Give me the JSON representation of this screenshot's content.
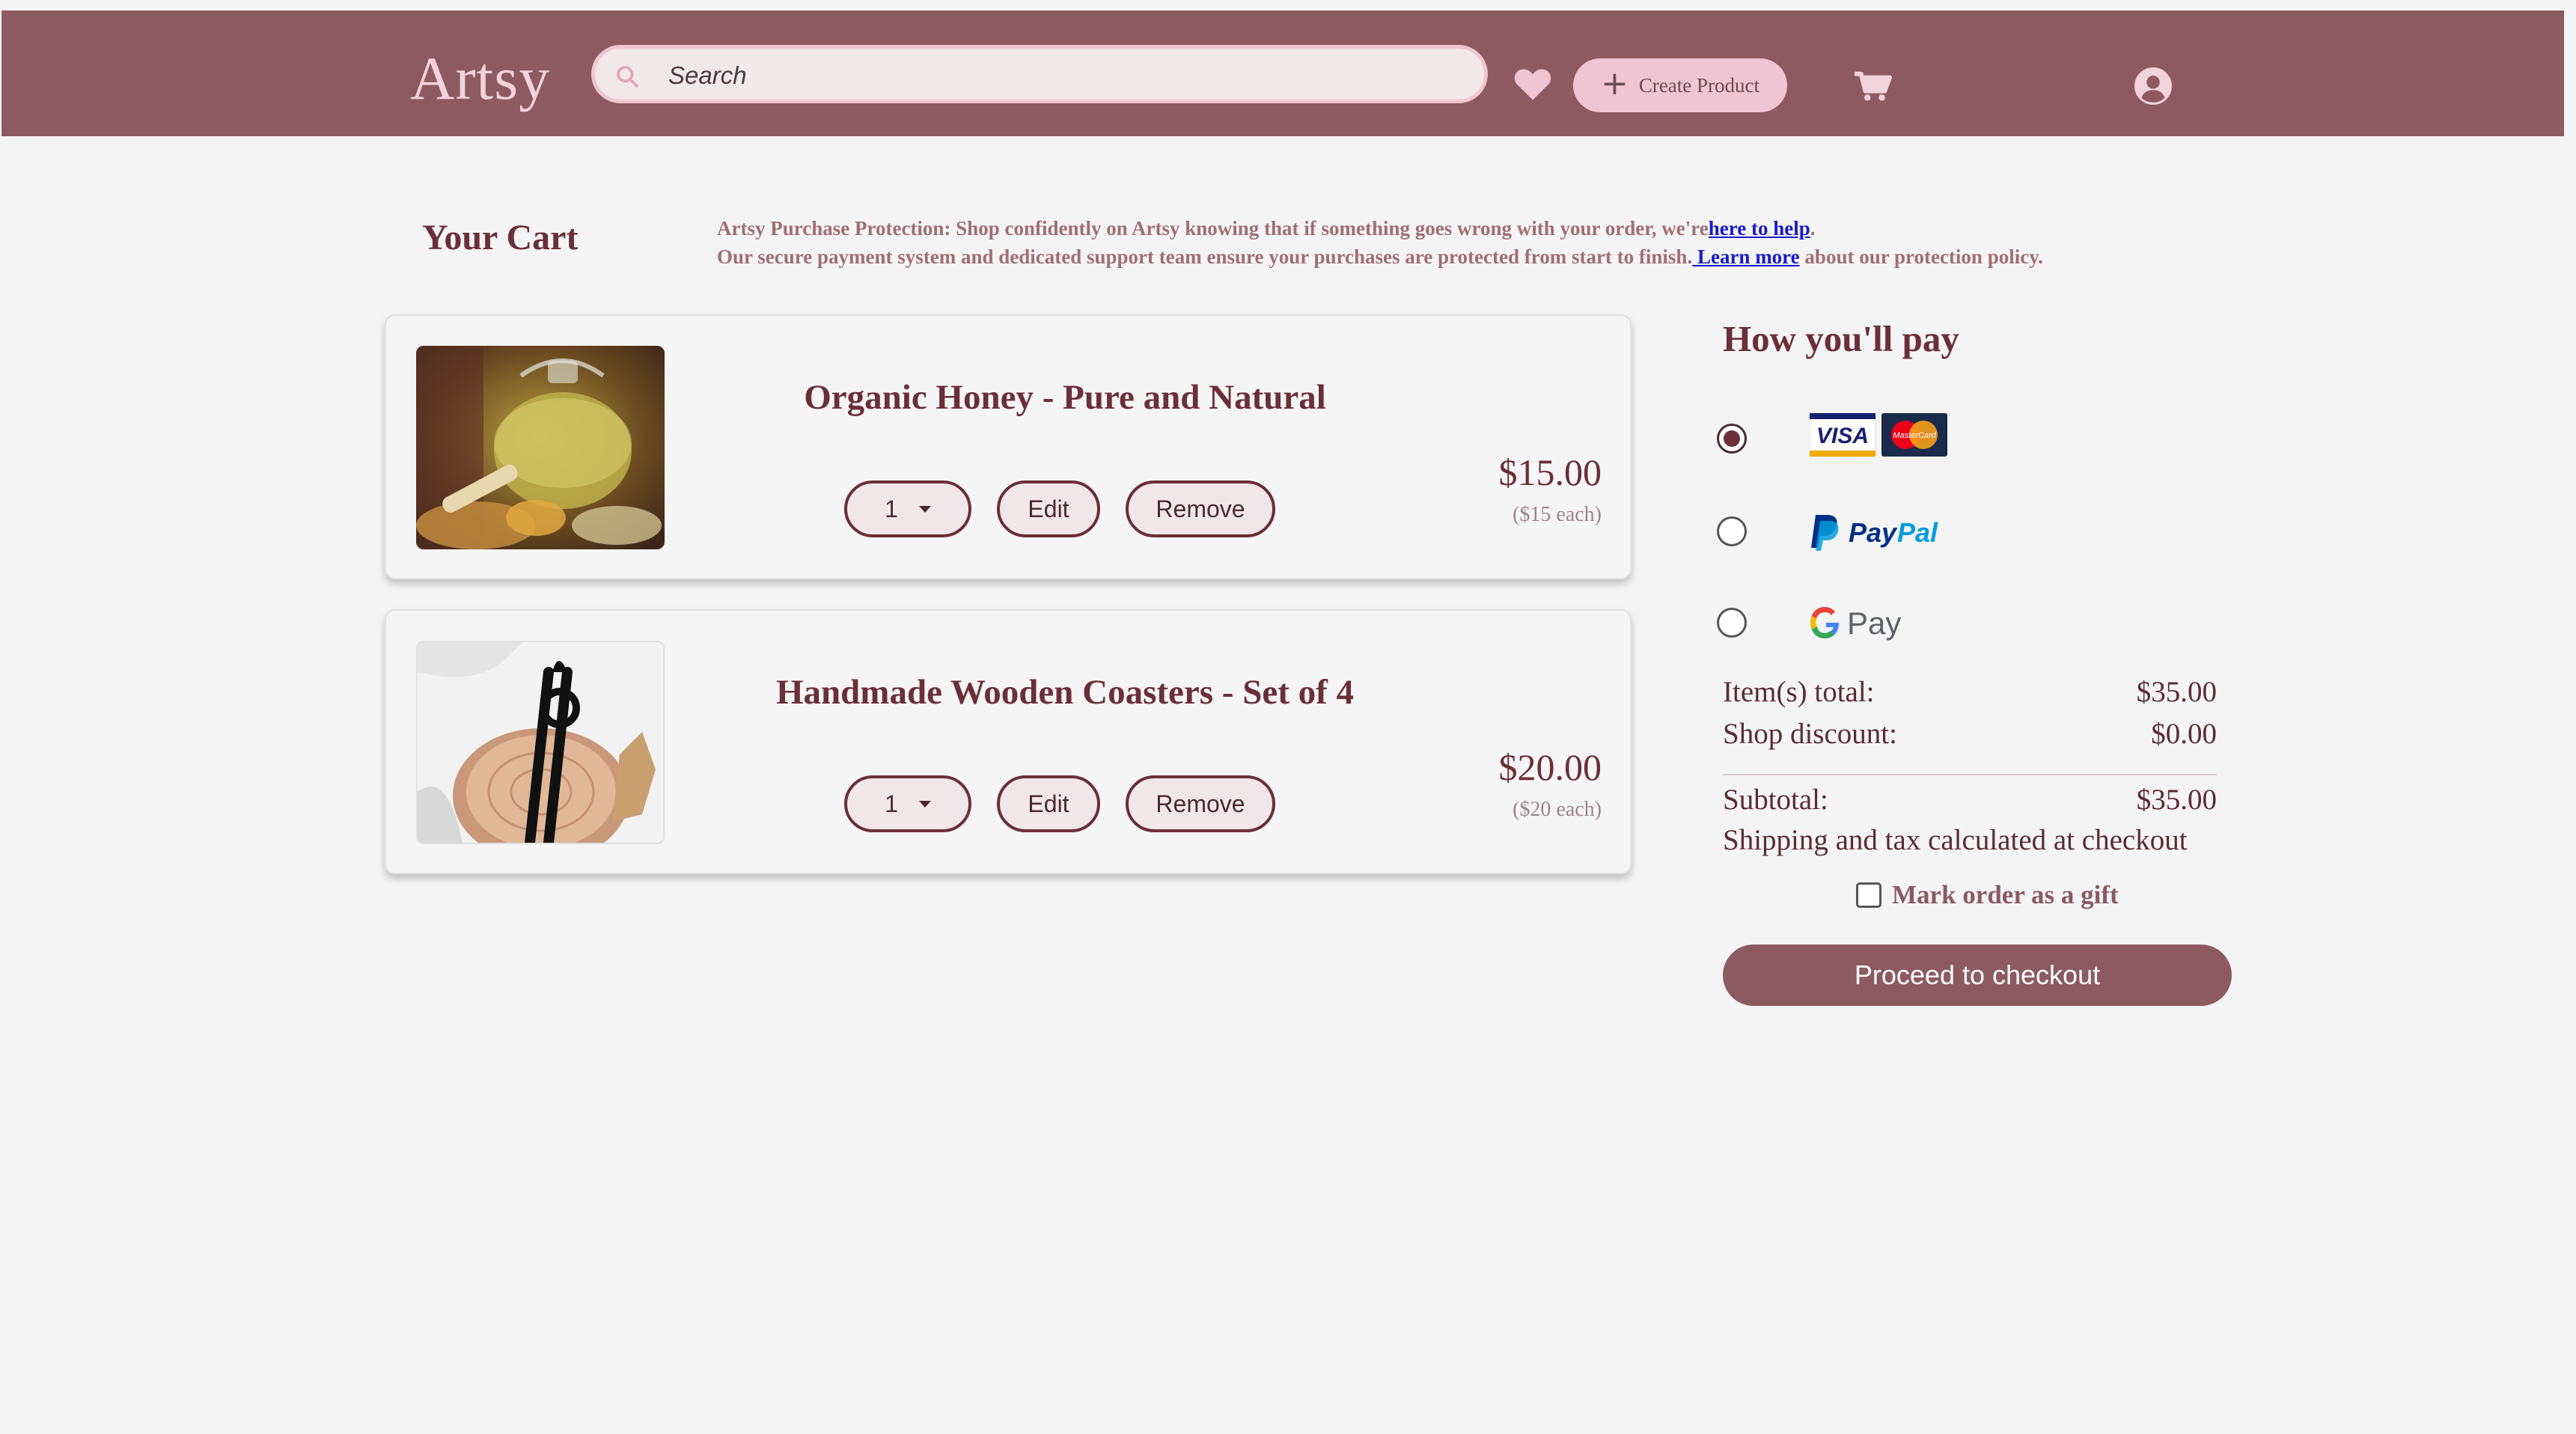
{
  "header": {
    "logo": "Artsy",
    "search_placeholder": "Search",
    "create_label": "Create Product"
  },
  "cart": {
    "title": "Your Cart",
    "protection_line1": "Artsy Purchase Protection: Shop confidently on Artsy knowing that if something goes wrong with your order, we're",
    "protection_link1": "here to help",
    "protection_line1_end": ".",
    "protection_line2": "Our secure payment system and dedicated support team ensure your purchases are protected from start to finish.",
    "protection_link2": " Learn more",
    "protection_line2_end": " about our protection policy.",
    "items": [
      {
        "name": "Organic Honey - Pure and Natural",
        "qty": "1",
        "edit": "Edit",
        "remove": "Remove",
        "price": "$15.00",
        "each": "($15 each)"
      },
      {
        "name": "Handmade Wooden Coasters - Set of 4",
        "qty": "1",
        "edit": "Edit",
        "remove": "Remove",
        "price": "$20.00",
        "each": "($20 each)"
      }
    ]
  },
  "payment": {
    "title": "How you'll pay",
    "options": [
      {
        "name": "card",
        "visa": "VISA",
        "mastercard": "MasterCard",
        "selected": true
      },
      {
        "name": "paypal",
        "label_pay": "Pay",
        "label_pal": "Pal",
        "selected": false
      },
      {
        "name": "gpay",
        "label": "Pay",
        "selected": false
      }
    ],
    "items_total_label": "Item(s) total:",
    "items_total": "$35.00",
    "discount_label": "Shop discount:",
    "discount": "$0.00",
    "subtotal_label": "Subtotal:",
    "subtotal": "$35.00",
    "shipping_note": "Shipping and tax calculated at checkout",
    "gift_label": "Mark order as a gift",
    "checkout_label": "Proceed to checkout"
  },
  "colors": {
    "brand": "#8d5a62",
    "accent_pink": "#efc4d3",
    "text_dark": "#6b2f3a"
  }
}
